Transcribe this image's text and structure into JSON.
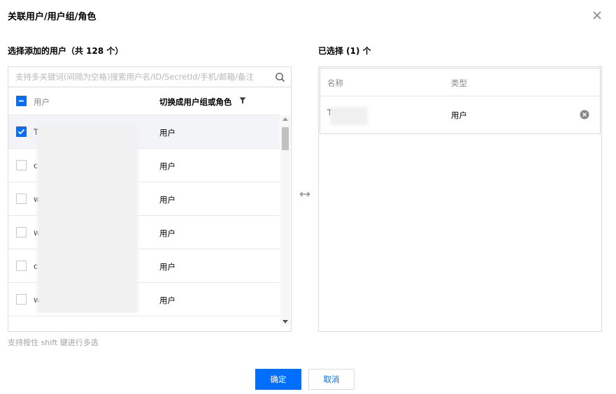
{
  "dialog": {
    "title": "关联用户/用户组/角色",
    "close_icon": "close-icon"
  },
  "left": {
    "heading": "选择添加的用户（共 128 个）",
    "search_placeholder": "支持多关键词(间隔为空格)搜索用户名/ID/SecretId/手机/邮箱/备注",
    "header": {
      "user": "用户",
      "switch": "切换成用户组或角色"
    },
    "rows": [
      {
        "initial": "T",
        "type": "用户",
        "checked": true
      },
      {
        "initial": "c",
        "type": "用户",
        "checked": false
      },
      {
        "initial": "w",
        "type": "用户",
        "checked": false
      },
      {
        "initial": "w",
        "type": "用户",
        "checked": false
      },
      {
        "initial": "c",
        "type": "用户",
        "checked": false
      },
      {
        "initial": "w",
        "type": "用户",
        "checked": false
      }
    ],
    "hint": "支持按住 shift 键进行多选"
  },
  "right": {
    "heading": "已选择 (1) 个",
    "header": {
      "name": "名称",
      "type": "类型"
    },
    "rows": [
      {
        "initial": "T",
        "type": "用户"
      }
    ]
  },
  "footer": {
    "ok": "确定",
    "cancel": "取消"
  },
  "colors": {
    "primary": "#006eff",
    "selected_row": "#f2f4f8"
  }
}
